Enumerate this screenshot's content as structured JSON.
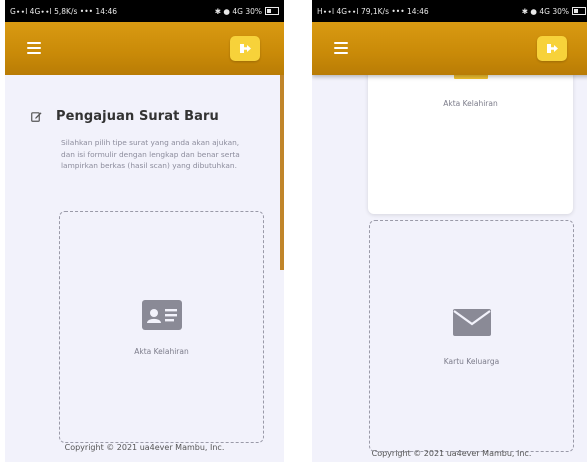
{
  "left": {
    "status": {
      "left": "G∙∙l 4G∙∙l 5,8K/s ••• 14:46",
      "right": "✱ ● 4G 30%"
    },
    "title": "Pengajuan Surat Baru",
    "description": "Silahkan pilih tipe surat yang anda akan ajukan, dan isi formulir dengan lengkap dan benar serta lampirkan berkas (hasil scan) yang dibutuhkan.",
    "card_label": "Akta Kelahiran",
    "footer": "Copyright © 2021 ua4ever Mambu, Inc."
  },
  "right": {
    "status": {
      "left": "H∙∙l 4G∙∙l 79,1K/s ••• 14:46",
      "right": "✱ ● 4G 30%"
    },
    "card_top_label": "Akta Kelahiran",
    "card_label": "Kartu Keluarga",
    "footer": "Copyright © 2021 ua4ever Mambu, Inc."
  },
  "icons": {
    "menu": "hamburger-icon",
    "logout": "logout-icon",
    "edit": "edit-icon",
    "id_card": "id-card-icon",
    "envelope": "envelope-icon"
  },
  "colors": {
    "appbar": "#c98a08",
    "logout_button": "#f7d23a",
    "content_bg": "#f2f2fb",
    "icon_gray": "#8a8a96"
  }
}
